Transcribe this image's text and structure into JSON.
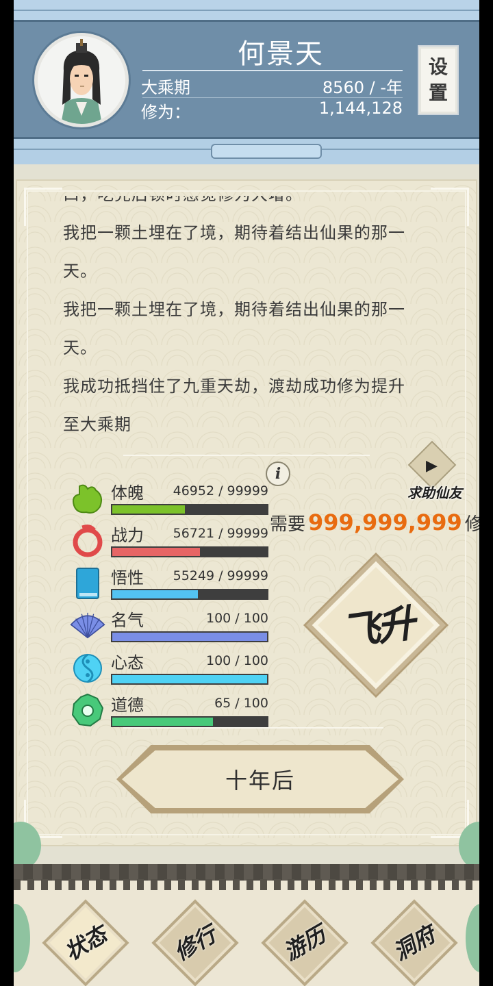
{
  "header": {
    "name": "何景天",
    "realm": "大乘期",
    "lifespan": "8560 / -年",
    "cultivation_label": "修为：",
    "cultivation_value": "1,144,128",
    "settings_chars": [
      "设",
      "置"
    ]
  },
  "story": {
    "lines": [
      "口，吃完后顿时感觉修为大增。",
      "我把一颗土埋在了境，期待着结出仙果的那一",
      "天。",
      "我把一颗土埋在了境，期待着结出仙果的那一",
      "天。",
      "我成功抵挡住了九重天劫，渡劫成功修为提升",
      "至大乘期"
    ]
  },
  "stats": [
    {
      "label": "体魄",
      "value": "46952 / 99999",
      "fill": 0.4695,
      "color": "#7cc22a",
      "icon": "body-icon"
    },
    {
      "label": "战力",
      "value": "56721 / 99999",
      "fill": 0.5672,
      "color": "#e76565",
      "icon": "combat-icon"
    },
    {
      "label": "悟性",
      "value": "55249 / 99999",
      "fill": 0.5525,
      "color": "#53c3f2",
      "icon": "book-icon"
    },
    {
      "label": "名气",
      "value": "100 / 100",
      "fill": 1.0,
      "color": "#7a8ee6",
      "icon": "fan-icon"
    },
    {
      "label": "心态",
      "value": "100 / 100",
      "fill": 1.0,
      "color": "#4fd2f4",
      "icon": "yinyang-icon"
    },
    {
      "label": "道德",
      "value": "65 / 100",
      "fill": 0.65,
      "color": "#48c97a",
      "icon": "flower-icon"
    }
  ],
  "info_symbol": "i",
  "help": {
    "icon": "▶",
    "label": "求助仙友"
  },
  "ascend": {
    "need_prefix": "需要",
    "amount": "999,999,999",
    "need_suffix": "修为",
    "label": "飞升"
  },
  "next_button": "十年后",
  "nav": [
    {
      "label": "状态",
      "active": true
    },
    {
      "label": "修行",
      "active": false
    },
    {
      "label": "游历",
      "active": false
    },
    {
      "label": "洞府",
      "active": false
    }
  ]
}
